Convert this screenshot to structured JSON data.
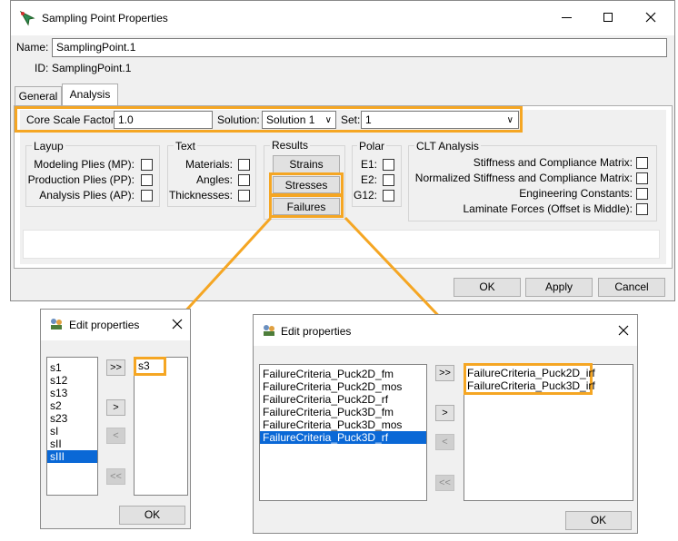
{
  "main_window": {
    "title": "Sampling Point Properties",
    "name_label": "Name:",
    "name_value": "SamplingPoint.1",
    "id_label": "ID:",
    "id_value": "SamplingPoint.1",
    "tabs": [
      "General",
      "Analysis"
    ],
    "core_scale_label": "Core Scale Factor:",
    "core_scale_value": "1.0",
    "solution_label": "Solution:",
    "solution_value": "Solution 1",
    "set_label": "Set:",
    "set_value": "1",
    "layup": {
      "title": "Layup",
      "items": [
        "Modeling Plies (MP):",
        "Production Plies (PP):",
        "Analysis Plies (AP):"
      ]
    },
    "text": {
      "title": "Text",
      "items": [
        "Materials:",
        "Angles:",
        "Thicknesses:"
      ]
    },
    "results": {
      "title": "Results",
      "buttons": [
        "Strains",
        "Stresses",
        "Failures"
      ]
    },
    "polar": {
      "title": "Polar",
      "items": [
        "E1:",
        "E2:",
        "G12:"
      ]
    },
    "clt": {
      "title": "CLT Analysis",
      "items": [
        "Stiffness and Compliance Matrix:",
        "Normalized Stiffness and Compliance Matrix:",
        "Engineering Constants:",
        "Laminate Forces (Offset is Middle):"
      ]
    },
    "ok": "OK",
    "apply": "Apply",
    "cancel": "Cancel"
  },
  "stress_dialog": {
    "title": "Edit properties",
    "available": [
      "s1",
      "s12",
      "s13",
      "s2",
      "s23",
      "sI",
      "sII",
      "sIII"
    ],
    "selected_index": 7,
    "chosen": [
      "s3"
    ],
    "add_all": ">>",
    "add": ">",
    "remove": "<",
    "remove_all": "<<",
    "ok": "OK"
  },
  "failure_dialog": {
    "title": "Edit properties",
    "available": [
      "FailureCriteria_Puck2D_fm",
      "FailureCriteria_Puck2D_mos",
      "FailureCriteria_Puck2D_rf",
      "FailureCriteria_Puck3D_fm",
      "FailureCriteria_Puck3D_mos",
      "FailureCriteria_Puck3D_rf"
    ],
    "selected_index": 5,
    "chosen": [
      "FailureCriteria_Puck2D_irf",
      "FailureCriteria_Puck3D_irf"
    ],
    "add_all": ">>",
    "add": ">",
    "remove": "<",
    "remove_all": "<<",
    "ok": "OK"
  },
  "colors": {
    "highlight": "#f5a623",
    "selection": "#0a68d6",
    "window_bg": "#f0f0f0"
  }
}
